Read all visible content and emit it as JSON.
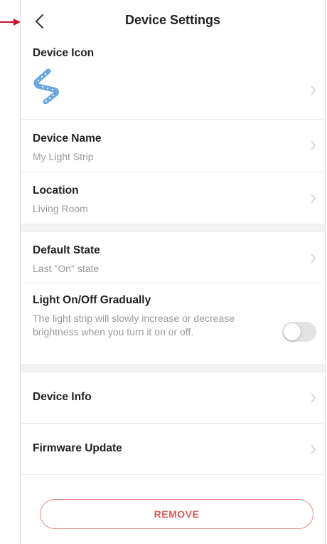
{
  "header": {
    "title": "Device Settings"
  },
  "rows": {
    "icon": {
      "label": "Device Icon"
    },
    "name": {
      "label": "Device Name",
      "value": "My Light Strip"
    },
    "location": {
      "label": "Location",
      "value": "Living Room"
    },
    "default_state": {
      "label": "Default State",
      "value": "Last \"On\" state"
    },
    "fade": {
      "label": "Light On/Off Gradually",
      "description": "The light strip will slowly increase or decrease brightness when you turn it on or off.",
      "enabled": false
    },
    "device_info": {
      "label": "Device Info"
    },
    "firmware": {
      "label": "Firmware Update"
    }
  },
  "remove": {
    "label": "REMOVE"
  },
  "colors": {
    "accent_red": "#e05a5a",
    "pointer_red": "#c8102e",
    "icon_blue": "#6aa8dd"
  },
  "icons": {
    "back": "chevron-left-icon",
    "row": "chevron-right-icon",
    "device": "light-strip-icon"
  }
}
